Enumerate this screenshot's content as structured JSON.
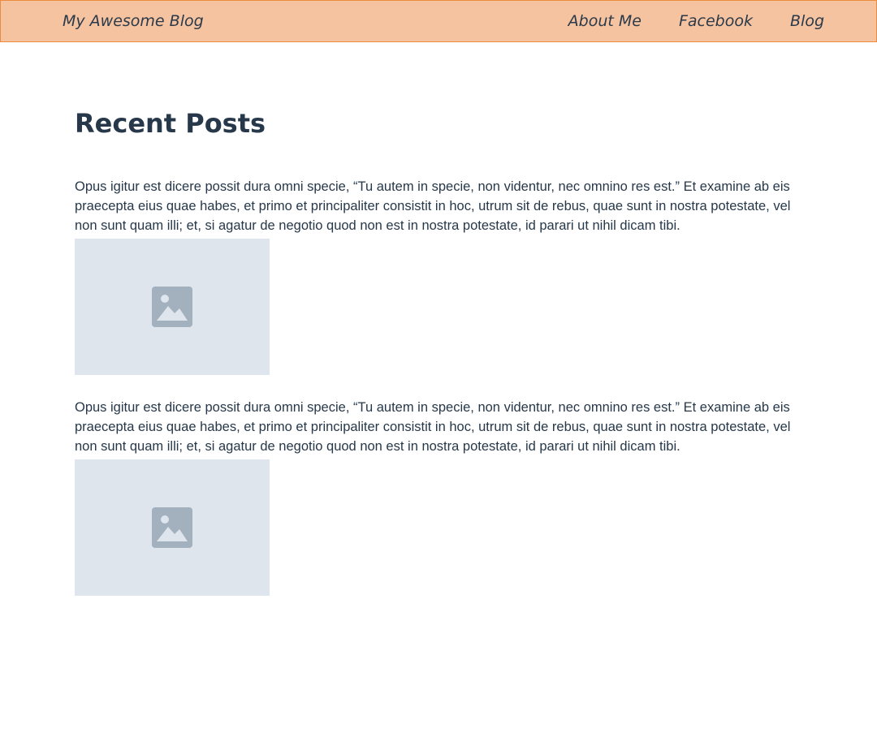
{
  "header": {
    "brand": "My Awesome Blog",
    "nav": [
      {
        "label": "About Me"
      },
      {
        "label": "Facebook"
      },
      {
        "label": "Blog"
      }
    ]
  },
  "main": {
    "title": "Recent Posts",
    "posts": [
      {
        "text": "Opus igitur est dicere possit dura omni specie, “Tu autem in specie, non videntur, nec omnino res est.” Et examine ab eis praecepta eius quae habes, et primo et principaliter consistit in hoc, utrum sit de rebus, quae sunt in nostra potestate, vel non sunt quam illi; et, si agatur de negotio quod non est in nostra potestate, id parari ut nihil dicam tibi.",
        "image_icon": "image-placeholder-icon"
      },
      {
        "text": "Opus igitur est dicere possit dura omni specie, “Tu autem in specie, non videntur, nec omnino res est.” Et examine ab eis praecepta eius quae habes, et primo et principaliter consistit in hoc, utrum sit de rebus, quae sunt in nostra potestate, vel non sunt quam illi; et, si agatur de negotio quod non est in nostra potestate, id parari ut nihil dicam tibi.",
        "image_icon": "image-placeholder-icon"
      }
    ]
  },
  "colors": {
    "header_bg": "#f5c3a0",
    "header_border": "#ec8a3e",
    "text": "#26384a",
    "placeholder_bg": "#dfe5ed",
    "placeholder_icon": "#a3b0bd"
  }
}
